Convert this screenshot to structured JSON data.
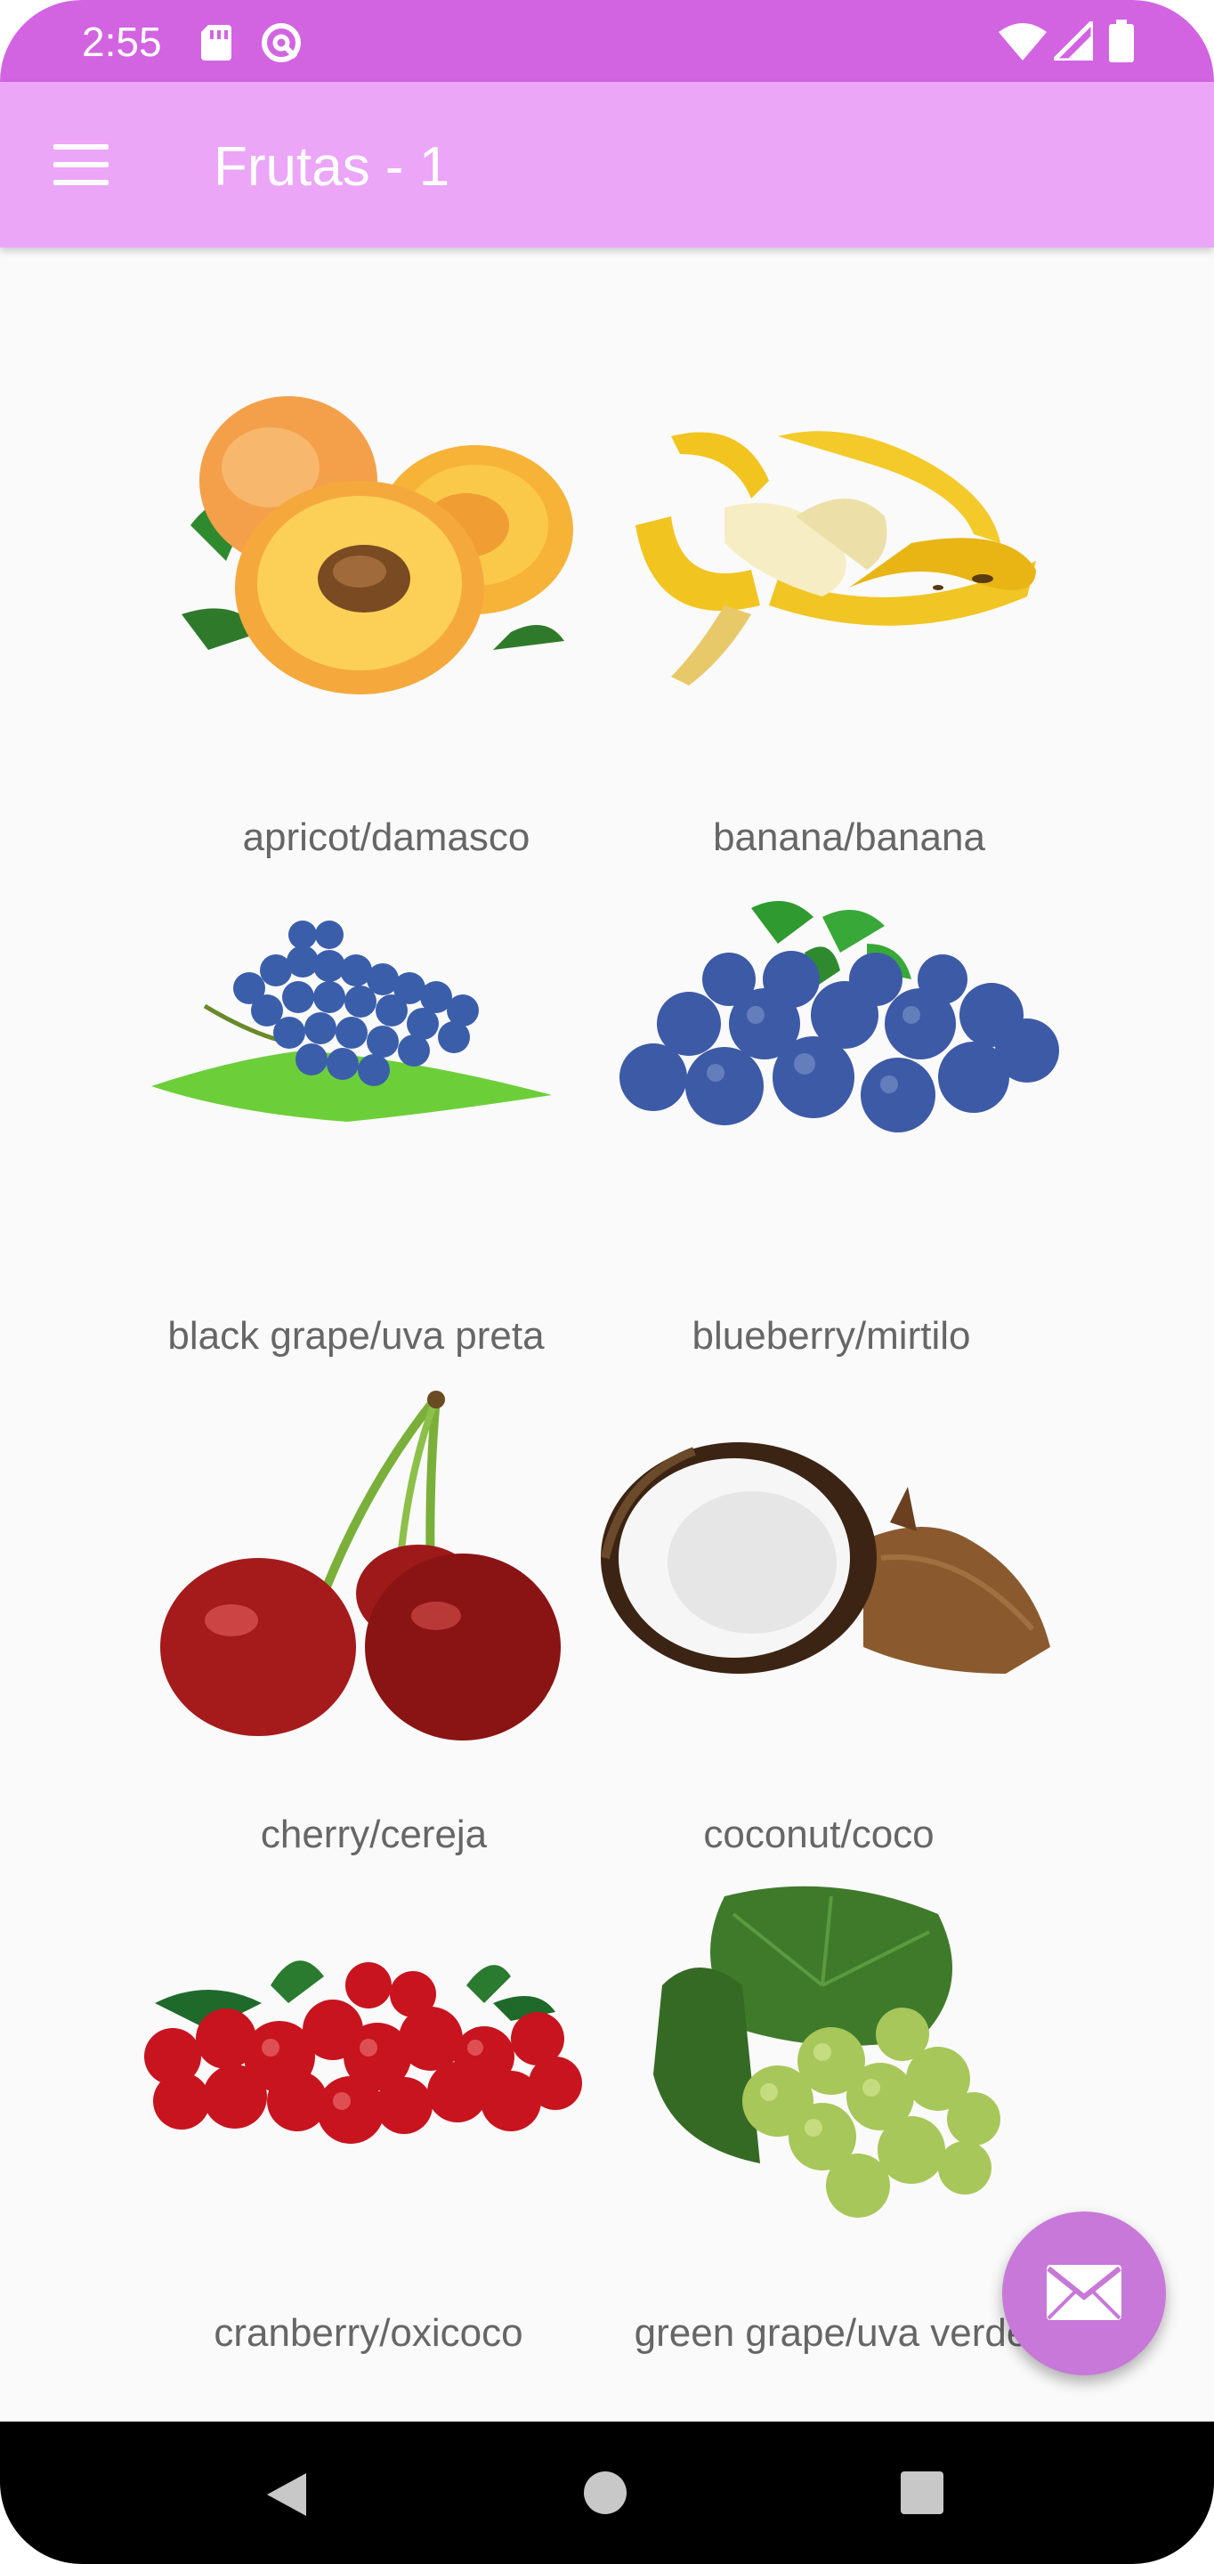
{
  "status_bar": {
    "time": "2:55",
    "icons": [
      "sd-card-icon",
      "q-icon",
      "wifi-icon",
      "signal-icon",
      "battery-icon"
    ]
  },
  "app_bar": {
    "title": "Frutas - 1",
    "menu_icon": "menu-icon"
  },
  "fruits": [
    {
      "label": "apricot/damasco",
      "image": "apricot-image"
    },
    {
      "label": "banana/banana",
      "image": "banana-image"
    },
    {
      "label": "black grape/uva preta",
      "image": "black-grape-image"
    },
    {
      "label": "blueberry/mirtilo",
      "image": "blueberry-image"
    },
    {
      "label": "cherry/cereja",
      "image": "cherry-image"
    },
    {
      "label": "coconut/coco",
      "image": "coconut-image"
    },
    {
      "label": "cranberry/oxicoco",
      "image": "cranberry-image"
    },
    {
      "label": "green grape/uva verde",
      "image": "green-grape-image"
    }
  ],
  "fab": {
    "icon": "mail-icon"
  },
  "nav_bar": {
    "icons": [
      "back-icon",
      "home-icon",
      "recents-icon"
    ]
  },
  "colors": {
    "status_bar": "#d264e2",
    "app_bar": "#eba6f7",
    "fab": "#c878d8",
    "background": "#fafafa",
    "label_text": "#666666"
  }
}
